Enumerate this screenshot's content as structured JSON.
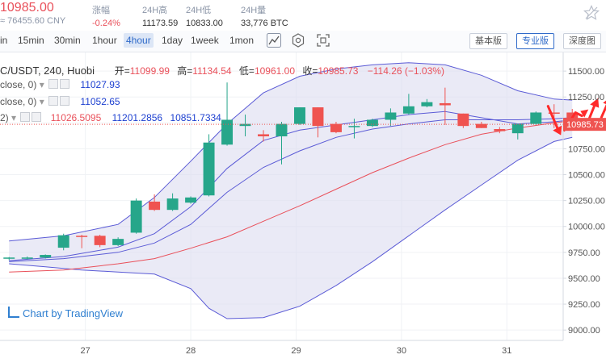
{
  "ticker": {
    "price": "10985.00",
    "cny": "≈ 76455.60 CNY",
    "change_label": "涨幅",
    "change_value": "-0.24%",
    "high_label": "24H高",
    "high_value": "11173.59",
    "low_label": "24H低",
    "low_value": "10833.00",
    "volume_label": "24H量",
    "volume_value": "33,776 BTC"
  },
  "toolbar": {
    "timeframes": [
      "in",
      "15min",
      "30min",
      "1hour",
      "4hour",
      "1day",
      "1week",
      "1mon"
    ],
    "active_timeframe": "4hour",
    "views": [
      "基本版",
      "专业版",
      "深度图"
    ],
    "active_view": "专业版",
    "icons": [
      "candlestick-icon",
      "gear-icon",
      "fullscreen-icon"
    ]
  },
  "legend": {
    "title": "C/USDT, 240, Huobi",
    "ohlc": {
      "open_label": "开=",
      "open": "11099.99",
      "high_label": "高=",
      "high": "11134.54",
      "low_label": "低=",
      "low": "10961.00",
      "close_label": "收=",
      "close": "10985.73",
      "change": "−114.26 (−1.03%)"
    },
    "indicators": [
      {
        "name": "close, 0)",
        "value": "11027.93"
      },
      {
        "name": " close, 0)",
        "value": "11052.65"
      },
      {
        "name": "2)",
        "values": [
          "11026.5095",
          "11201.2856",
          "10851.7334"
        ]
      }
    ]
  },
  "watermark": "Chart by TradingView",
  "colors": {
    "up": "#26a68a",
    "down": "#ef5350",
    "band_fill": "#dcdcf0",
    "band_line": "#5b5bd6",
    "ma_red": "#e9505a",
    "price_tag": "#ef5350",
    "arrow": "#ff2a2a"
  },
  "chart_data": {
    "type": "candlestick",
    "title": "C/USDT, 240, Huobi",
    "ylim": [
      8900,
      11680
    ],
    "y_ticks": [
      11500,
      11250,
      11000,
      10750,
      10500,
      10250,
      10000,
      9750,
      9500,
      9250,
      9000
    ],
    "y_tick_labels": [
      "11500.00",
      "11250.00",
      "11000.00",
      "10750.00",
      "10500.00",
      "10250.00",
      "10000.00",
      "9750.00",
      "9500.00",
      "9250.00",
      "9000.00"
    ],
    "x_labels": [
      {
        "label": "27",
        "at": 4.2
      },
      {
        "label": "28",
        "at": 10.0
      },
      {
        "label": "29",
        "at": 15.8
      },
      {
        "label": "30",
        "at": 21.6
      },
      {
        "label": "31",
        "at": 27.4
      }
    ],
    "n_slots": 31,
    "candles": [
      {
        "o": 9690,
        "h": 9705,
        "l": 9675,
        "c": 9700
      },
      {
        "o": 9690,
        "h": 9710,
        "l": 9680,
        "c": 9700
      },
      {
        "o": 9700,
        "h": 9730,
        "l": 9690,
        "c": 9725
      },
      {
        "o": 9795,
        "h": 9930,
        "l": 9770,
        "c": 9915
      },
      {
        "o": 9910,
        "h": 9920,
        "l": 9790,
        "c": 9900
      },
      {
        "o": 9910,
        "h": 9920,
        "l": 9800,
        "c": 9820
      },
      {
        "o": 9820,
        "h": 9895,
        "l": 9810,
        "c": 9880
      },
      {
        "o": 9940,
        "h": 10270,
        "l": 9930,
        "c": 10250
      },
      {
        "o": 10240,
        "h": 10310,
        "l": 10150,
        "c": 10160
      },
      {
        "o": 10160,
        "h": 10320,
        "l": 10150,
        "c": 10270
      },
      {
        "o": 10230,
        "h": 10290,
        "l": 10220,
        "c": 10280
      },
      {
        "o": 10300,
        "h": 10890,
        "l": 10290,
        "c": 10810
      },
      {
        "o": 10790,
        "h": 11390,
        "l": 10780,
        "c": 11030
      },
      {
        "o": 10970,
        "h": 11080,
        "l": 10870,
        "c": 10990
      },
      {
        "o": 10890,
        "h": 10930,
        "l": 10820,
        "c": 10870
      },
      {
        "o": 10870,
        "h": 11010,
        "l": 10600,
        "c": 10990
      },
      {
        "o": 10990,
        "h": 11150,
        "l": 10980,
        "c": 11150
      },
      {
        "o": 11150,
        "h": 11150,
        "l": 10860,
        "c": 10970
      },
      {
        "o": 10990,
        "h": 11010,
        "l": 10900,
        "c": 10910
      },
      {
        "o": 10960,
        "h": 11040,
        "l": 10850,
        "c": 10970
      },
      {
        "o": 10970,
        "h": 11040,
        "l": 10960,
        "c": 11030
      },
      {
        "o": 11030,
        "h": 11140,
        "l": 10970,
        "c": 11100
      },
      {
        "o": 11090,
        "h": 11280,
        "l": 11080,
        "c": 11160
      },
      {
        "o": 11160,
        "h": 11230,
        "l": 11150,
        "c": 11200
      },
      {
        "o": 11190,
        "h": 11340,
        "l": 10980,
        "c": 11170
      },
      {
        "o": 11090,
        "h": 11090,
        "l": 10950,
        "c": 10970
      },
      {
        "o": 10990,
        "h": 11010,
        "l": 10950,
        "c": 10950
      },
      {
        "o": 10940,
        "h": 10960,
        "l": 10900,
        "c": 10920
      },
      {
        "o": 10900,
        "h": 10990,
        "l": 10840,
        "c": 10990
      },
      {
        "o": 10990,
        "h": 11110,
        "l": 10980,
        "c": 11100
      },
      {
        "o": 11100,
        "h": 11180,
        "l": 10950,
        "c": 11099.99
      },
      {
        "o": 11099.99,
        "h": 11134.54,
        "l": 10961,
        "c": 10985.73
      }
    ],
    "bb_upper": [
      [
        0,
        9860
      ],
      [
        3,
        9910
      ],
      [
        6,
        10020
      ],
      [
        8,
        10280
      ],
      [
        10,
        10630
      ],
      [
        12,
        10990
      ],
      [
        14,
        11290
      ],
      [
        16,
        11450
      ],
      [
        18,
        11520
      ],
      [
        20,
        11560
      ],
      [
        22,
        11580
      ],
      [
        24,
        11560
      ],
      [
        26,
        11460
      ],
      [
        28,
        11310
      ],
      [
        30,
        11230
      ],
      [
        31,
        11220
      ]
    ],
    "bb_lower": [
      [
        0,
        9640
      ],
      [
        2,
        9610
      ],
      [
        4,
        9580
      ],
      [
        6,
        9560
      ],
      [
        8,
        9540
      ],
      [
        10,
        9400
      ],
      [
        11,
        9210
      ],
      [
        12,
        9110
      ],
      [
        14,
        9120
      ],
      [
        16,
        9230
      ],
      [
        18,
        9430
      ],
      [
        20,
        9660
      ],
      [
        22,
        9910
      ],
      [
        24,
        10160
      ],
      [
        26,
        10400
      ],
      [
        28,
        10640
      ],
      [
        30,
        10820
      ],
      [
        31,
        10860
      ]
    ],
    "ma_short": [
      [
        0,
        9670
      ],
      [
        3,
        9710
      ],
      [
        6,
        9800
      ],
      [
        8,
        9930
      ],
      [
        10,
        10190
      ],
      [
        12,
        10560
      ],
      [
        14,
        10830
      ],
      [
        16,
        10930
      ],
      [
        18,
        10980
      ],
      [
        20,
        11030
      ],
      [
        22,
        11080
      ],
      [
        24,
        11110
      ],
      [
        26,
        11050
      ],
      [
        28,
        10990
      ],
      [
        30,
        11010
      ],
      [
        31,
        11030
      ]
    ],
    "ma_mid": [
      [
        0,
        9660
      ],
      [
        3,
        9690
      ],
      [
        6,
        9750
      ],
      [
        8,
        9840
      ],
      [
        10,
        10020
      ],
      [
        12,
        10330
      ],
      [
        14,
        10570
      ],
      [
        16,
        10730
      ],
      [
        18,
        10860
      ],
      [
        20,
        10940
      ],
      [
        22,
        10990
      ],
      [
        24,
        11030
      ],
      [
        26,
        11030
      ],
      [
        28,
        11030
      ],
      [
        30,
        11040
      ],
      [
        31,
        11050
      ]
    ],
    "ma_long": [
      [
        0,
        9560
      ],
      [
        3,
        9580
      ],
      [
        6,
        9640
      ],
      [
        8,
        9690
      ],
      [
        10,
        9790
      ],
      [
        12,
        9900
      ],
      [
        14,
        10050
      ],
      [
        16,
        10200
      ],
      [
        18,
        10360
      ],
      [
        20,
        10520
      ],
      [
        22,
        10660
      ],
      [
        24,
        10790
      ],
      [
        26,
        10890
      ],
      [
        28,
        10950
      ],
      [
        30,
        11000
      ],
      [
        31,
        11020
      ]
    ],
    "last_price": {
      "value": 10985.73,
      "label": "10985.73"
    }
  }
}
